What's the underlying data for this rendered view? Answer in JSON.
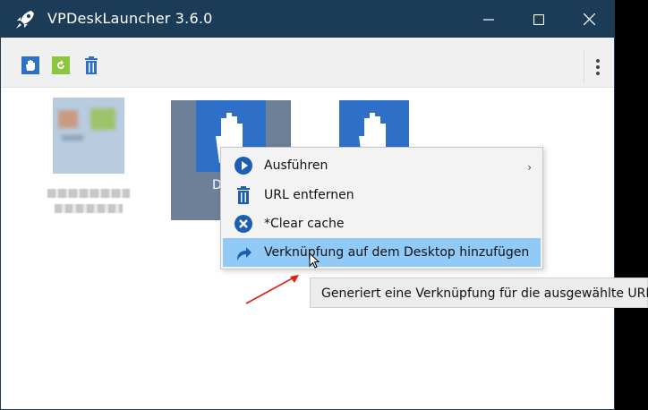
{
  "window": {
    "title": "VPDeskLauncher 3.6.0"
  },
  "tiles": [
    {
      "label": ""
    },
    {
      "label": "D"
    },
    {
      "label": ""
    }
  ],
  "context_menu": {
    "items": [
      {
        "label": "Ausführen",
        "icon": "play-circle-icon",
        "submenu": true
      },
      {
        "label": "URL entfernen",
        "icon": "trash-icon"
      },
      {
        "label": "*Clear cache",
        "icon": "close-circle-icon"
      },
      {
        "label": "Verknüpfung auf dem Desktop hinzufügen",
        "icon": "shortcut-arrow-icon",
        "highlighted": true
      }
    ]
  },
  "tooltip": {
    "text": "Generiert eine Verknüpfung für die ausgewählte URL"
  },
  "colors": {
    "titlebar": "#1c3b57",
    "highlight": "#91c9f7",
    "tile_blue": "#2e6fc8",
    "annotation": "#e0201b"
  }
}
